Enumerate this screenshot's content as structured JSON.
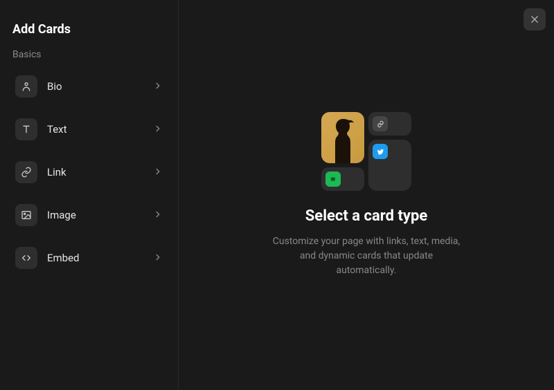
{
  "sidebar": {
    "title": "Add Cards",
    "sectionLabel": "Basics",
    "items": [
      {
        "label": "Bio"
      },
      {
        "label": "Text"
      },
      {
        "label": "Link"
      },
      {
        "label": "Image"
      },
      {
        "label": "Embed"
      }
    ]
  },
  "main": {
    "title": "Select a card type",
    "description": "Customize your page with links, text, media, and dynamic cards that update automatically."
  }
}
